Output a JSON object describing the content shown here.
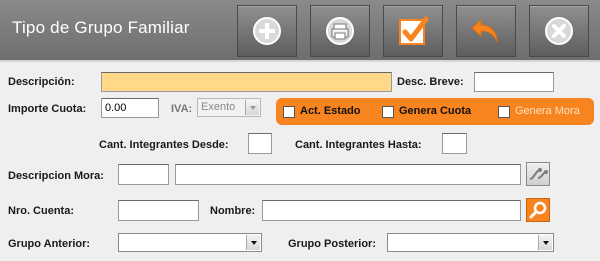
{
  "window": {
    "title": "Tipo de Grupo Familiar"
  },
  "toolbar": {
    "buttons": [
      {
        "name": "add",
        "icon": "plus-icon"
      },
      {
        "name": "print",
        "icon": "print-icon"
      },
      {
        "name": "confirm",
        "icon": "check-icon"
      },
      {
        "name": "undo",
        "icon": "undo-arrow-icon"
      },
      {
        "name": "close",
        "icon": "close-icon"
      }
    ]
  },
  "form": {
    "descripcion": {
      "label": "Descripción:",
      "value": ""
    },
    "desc_breve": {
      "label": "Desc. Breve:",
      "value": ""
    },
    "importe_cuota": {
      "label": "Importe Cuota:",
      "value": "0.00"
    },
    "iva": {
      "label": "IVA:",
      "value": "Exento"
    },
    "act_estado": {
      "label": "Act. Estado",
      "checked": false
    },
    "genera_cuota": {
      "label": "Genera Cuota",
      "checked": false
    },
    "genera_mora": {
      "label": "Genera Mora",
      "checked": false
    },
    "cant_desde": {
      "label": "Cant. Integrantes Desde:",
      "value": ""
    },
    "cant_hasta": {
      "label": "Cant. Integrantes Hasta:",
      "value": ""
    },
    "descripcion_mora": {
      "label": "Descripcion Mora:",
      "code": "",
      "value": ""
    },
    "nro_cuenta": {
      "label": "Nro. Cuenta:",
      "value": ""
    },
    "nombre": {
      "label": "Nombre:",
      "value": ""
    },
    "grupo_anterior": {
      "label": "Grupo Anterior:",
      "value": ""
    },
    "grupo_posterior": {
      "label": "Grupo Posterior:",
      "value": ""
    }
  },
  "colors": {
    "titlebar": "#7a7a7a",
    "required_field": "#ffd989",
    "accent_orange": "#f7841f"
  }
}
